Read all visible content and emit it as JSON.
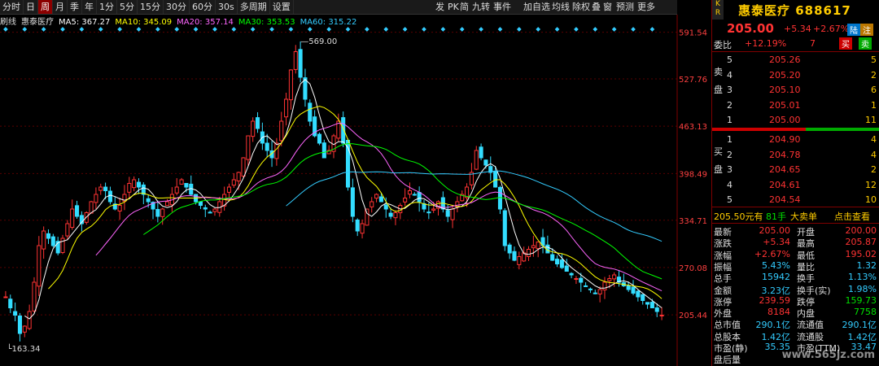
{
  "toolbar": {
    "left": [
      "分时",
      "日",
      "周",
      "月",
      "季",
      "年",
      "1分",
      "5分",
      "15分",
      "30分",
      "60分",
      "30s",
      "多周期",
      "设置"
    ],
    "active": "周",
    "right": [
      "发",
      "PK",
      "简",
      "九转",
      "事件",
      "加自选",
      "均线",
      "除权",
      "叠",
      "窗",
      "预测",
      "更多"
    ]
  },
  "ma_legend": [
    {
      "label": "刷线",
      "color": "#dddddd"
    },
    {
      "label": "惠泰医疗",
      "color": "#dddddd"
    },
    {
      "label": "MA5: 367.27",
      "color": "#ffffff"
    },
    {
      "label": "MA10: 345.09",
      "color": "#ffff00"
    },
    {
      "label": "MA20: 357.14",
      "color": "#ff66ff"
    },
    {
      "label": "MA30: 353.53",
      "color": "#00ff00"
    },
    {
      "label": "MA60: 315.22",
      "color": "#33ccff"
    }
  ],
  "chart_data": {
    "type": "candlestick",
    "ylim": [
      180,
      600
    ],
    "y_ticks": [
      "591.54",
      "527.76",
      "463.13",
      "398.49",
      "334.71",
      "270.08",
      "205.44"
    ],
    "y_tick_values": [
      591.54,
      527.76,
      463.13,
      398.49,
      334.71,
      270.08,
      205.44
    ],
    "annot_high": "569.00",
    "annot_low": "163.34",
    "series_closes": [
      230,
      215,
      205,
      180,
      190,
      210,
      250,
      300,
      320,
      310,
      300,
      290,
      310,
      330,
      350,
      340,
      330,
      345,
      360,
      370,
      380,
      375,
      360,
      350,
      355,
      370,
      385,
      390,
      380,
      370,
      360,
      350,
      340,
      350,
      360,
      370,
      380,
      390,
      380,
      370,
      360,
      355,
      350,
      345,
      350,
      360,
      370,
      380,
      390,
      400,
      420,
      450,
      470,
      460,
      440,
      430,
      420,
      440,
      470,
      500,
      540,
      565,
      530,
      500,
      470,
      450,
      440,
      420,
      430,
      450,
      470,
      440,
      380,
      340,
      320,
      330,
      350,
      360,
      370,
      360,
      350,
      340,
      345,
      355,
      365,
      375,
      370,
      360,
      350,
      345,
      350,
      360,
      350,
      340,
      350,
      360,
      370,
      380,
      400,
      430,
      420,
      410,
      400,
      380,
      350,
      300,
      290,
      280,
      285,
      290,
      295,
      300,
      305,
      300,
      290,
      280,
      275,
      270,
      265,
      260,
      255,
      250,
      245,
      240,
      235,
      240,
      250,
      255,
      260,
      250,
      245,
      240,
      235,
      230,
      225,
      220,
      215,
      210,
      205
    ]
  },
  "panel": {
    "kr": "K R",
    "name": "惠泰医疗",
    "code": "688617",
    "price": "205.00",
    "change": "+5.34",
    "change_pct": "+2.67%",
    "lujing": "陆",
    "zhu": "注",
    "weibi_label": "委比",
    "weibi": "+12.19%",
    "weibi_n": "7",
    "buy": "买",
    "sell": "卖",
    "sell_label": "卖盘",
    "buy_label": "买盘",
    "sells": [
      {
        "lvl": "5",
        "p": "205.26",
        "v": "5"
      },
      {
        "lvl": "4",
        "p": "205.20",
        "v": "2"
      },
      {
        "lvl": "3",
        "p": "205.10",
        "v": "6"
      },
      {
        "lvl": "2",
        "p": "205.01",
        "v": "1"
      },
      {
        "lvl": "1",
        "p": "205.00",
        "v": "11"
      }
    ],
    "buys": [
      {
        "lvl": "1",
        "p": "204.90",
        "v": "4"
      },
      {
        "lvl": "2",
        "p": "204.78",
        "v": "4"
      },
      {
        "lvl": "3",
        "p": "204.65",
        "v": "2"
      },
      {
        "lvl": "4",
        "p": "204.61",
        "v": "12"
      },
      {
        "lvl": "5",
        "p": "204.54",
        "v": "10"
      }
    ],
    "bigorder": {
      "p": "205.50元有",
      "n": "81手",
      "t": "大卖单",
      "link": "点击查看"
    },
    "stats": [
      [
        "最新",
        "205.00",
        "开盘",
        "200.00"
      ],
      [
        "涨跌",
        "+5.34",
        "最高",
        "205.87"
      ],
      [
        "涨幅",
        "+2.67%",
        "最低",
        "195.02"
      ],
      [
        "振幅",
        "5.43%",
        "量比",
        "1.32"
      ],
      [
        "总手",
        "15942",
        "换手",
        "1.13%"
      ],
      [
        "金额",
        "3.23亿",
        "换手(实)",
        "1.98%"
      ],
      [
        "涨停",
        "239.59",
        "跌停",
        "159.73"
      ],
      [
        "外盘",
        "8184",
        "内盘",
        "7758"
      ],
      [
        "总市值",
        "290.1亿",
        "流通值",
        "290.1亿"
      ],
      [
        "总股本",
        "1.42亿",
        "流通股",
        "1.42亿"
      ],
      [
        "市盈(静)",
        "35.35",
        "市盈(TTM)",
        "33.47"
      ],
      [
        "盘后量",
        "",
        "",
        ""
      ]
    ],
    "watermark": "www.565jz.com"
  }
}
